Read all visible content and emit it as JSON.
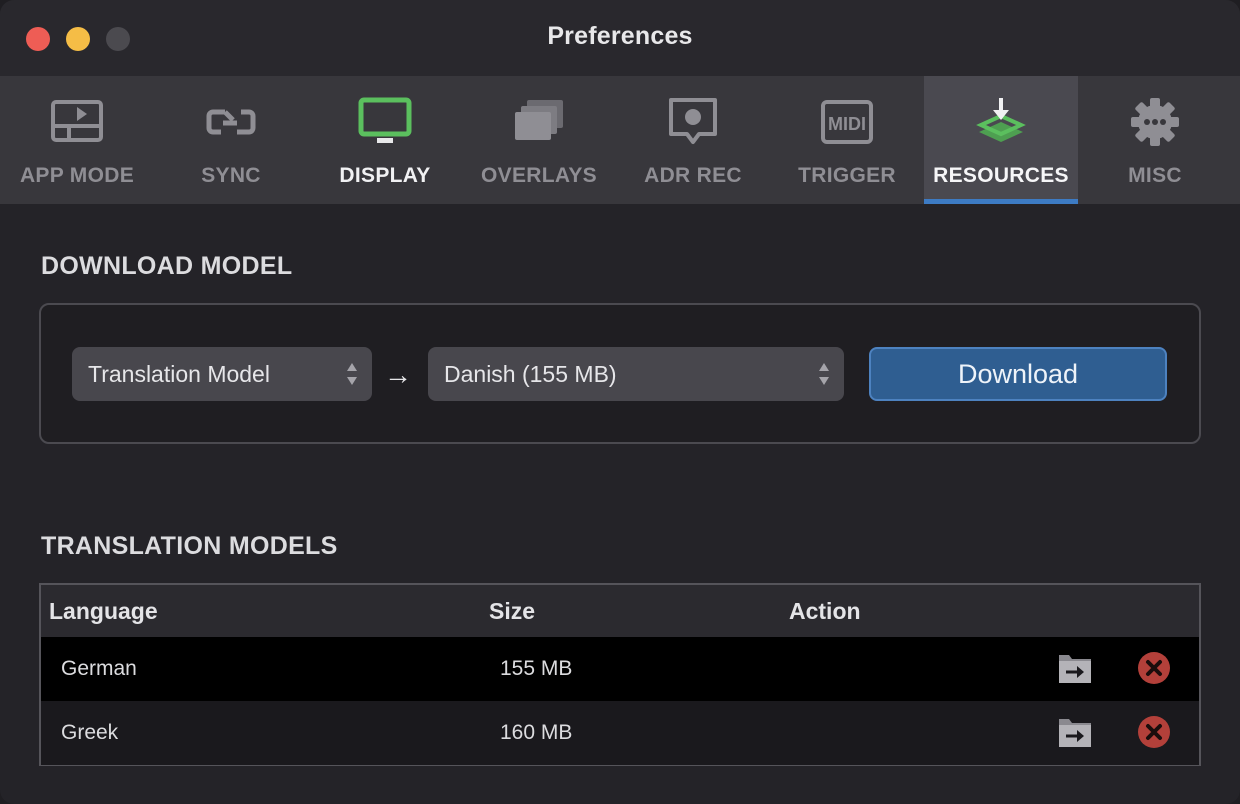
{
  "window": {
    "title": "Preferences"
  },
  "toolbar": {
    "tabs": [
      {
        "label": "APP MODE",
        "icon": "app-mode-icon"
      },
      {
        "label": "SYNC",
        "icon": "sync-icon"
      },
      {
        "label": "DISPLAY",
        "icon": "display-icon"
      },
      {
        "label": "OVERLAYS",
        "icon": "overlays-icon"
      },
      {
        "label": "ADR REC",
        "icon": "adr-rec-icon"
      },
      {
        "label": "TRIGGER",
        "icon": "midi-icon"
      },
      {
        "label": "RESOURCES",
        "icon": "resources-download-icon",
        "selected": true
      },
      {
        "label": "MISC",
        "icon": "gear-icon"
      }
    ],
    "accent_color": "#3d7bc4",
    "display_icon_color": "#5bbf5e",
    "resources_icon_color": "#5bbf5e"
  },
  "download_section": {
    "title": "DOWNLOAD MODEL",
    "model_type_select": "Translation Model",
    "arrow": "→",
    "language_select": "Danish (155 MB)",
    "download_label": "Download"
  },
  "models_section": {
    "title": "TRANSLATION MODELS",
    "columns": [
      "Language",
      "Size",
      "Action"
    ],
    "rows": [
      {
        "language": "German",
        "size": "155 MB"
      },
      {
        "language": "Greek",
        "size": "160 MB"
      }
    ],
    "remove_color": "#b3403a"
  }
}
